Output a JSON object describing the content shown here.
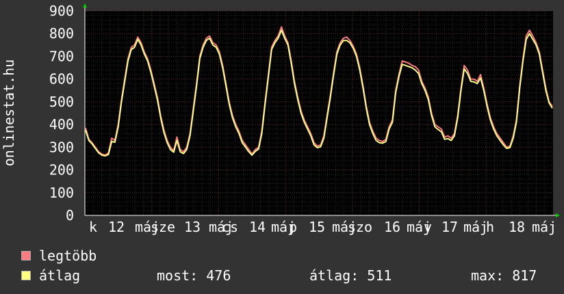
{
  "chart_data": {
    "type": "line",
    "ylabel": "onlinestat.hu",
    "ylim": [
      0,
      900
    ],
    "yticks": [
      "0",
      "100",
      "200",
      "300",
      "400",
      "500",
      "600",
      "700",
      "800",
      "900"
    ],
    "grid": true,
    "x_labels": [
      "k",
      "12",
      "máj",
      "sze",
      "13",
      "máj",
      "cs",
      "14",
      "máj",
      "p",
      "15",
      "máj",
      "szo",
      "16",
      "máj",
      "v",
      "17",
      "máj",
      "h",
      "18",
      "máj"
    ],
    "x_axis_note": "hourly samples over roughly 7 days; label sequence is day-of-week, day, month (május) as printed",
    "series": [
      {
        "name": "legtöbb",
        "color": "#ff7b82",
        "values": [
          385,
          335,
          320,
          300,
          280,
          270,
          265,
          275,
          340,
          330,
          400,
          510,
          600,
          690,
          740,
          750,
          785,
          760,
          720,
          690,
          640,
          580,
          520,
          440,
          375,
          330,
          300,
          285,
          345,
          290,
          280,
          300,
          360,
          470,
          580,
          700,
          750,
          780,
          790,
          760,
          750,
          720,
          660,
          580,
          500,
          440,
          400,
          370,
          330,
          310,
          290,
          270,
          290,
          300,
          370,
          500,
          620,
          740,
          770,
          790,
          830,
          790,
          760,
          680,
          590,
          520,
          460,
          420,
          390,
          360,
          320,
          305,
          310,
          350,
          440,
          530,
          630,
          720,
          760,
          780,
          785,
          770,
          745,
          710,
          650,
          570,
          480,
          410,
          370,
          340,
          330,
          325,
          335,
          390,
          420,
          550,
          620,
          680,
          675,
          670,
          660,
          655,
          640,
          590,
          560,
          520,
          450,
          400,
          390,
          380,
          345,
          350,
          340,
          360,
          440,
          560,
          660,
          640,
          600,
          600,
          590,
          620,
          560,
          490,
          430,
          390,
          360,
          340,
          320,
          300,
          305,
          350,
          420,
          570,
          690,
          790,
          815,
          790,
          760,
          720,
          640,
          560,
          500,
          480
        ]
      },
      {
        "name": "átlag",
        "color": "#ffff80",
        "values": [
          375,
          330,
          315,
          295,
          275,
          265,
          262,
          268,
          325,
          322,
          390,
          500,
          590,
          680,
          730,
          740,
          775,
          750,
          710,
          680,
          630,
          570,
          510,
          430,
          365,
          320,
          290,
          278,
          330,
          280,
          272,
          290,
          350,
          460,
          570,
          690,
          740,
          770,
          780,
          750,
          740,
          710,
          650,
          570,
          490,
          430,
          390,
          360,
          320,
          300,
          280,
          265,
          282,
          292,
          360,
          490,
          610,
          730,
          760,
          780,
          815,
          780,
          750,
          670,
          580,
          510,
          450,
          410,
          380,
          350,
          310,
          298,
          302,
          340,
          430,
          520,
          620,
          710,
          750,
          770,
          770,
          760,
          735,
          700,
          640,
          560,
          470,
          400,
          360,
          330,
          320,
          318,
          325,
          380,
          410,
          540,
          610,
          665,
          660,
          655,
          650,
          640,
          625,
          580,
          550,
          510,
          440,
          390,
          378,
          368,
          335,
          338,
          330,
          350,
          430,
          550,
          645,
          625,
          590,
          588,
          580,
          605,
          550,
          480,
          420,
          380,
          350,
          330,
          310,
          295,
          298,
          340,
          410,
          560,
          680,
          775,
          800,
          775,
          750,
          710,
          630,
          550,
          495,
          472
        ]
      }
    ]
  },
  "legend": [
    {
      "label": "legtöbb",
      "color": "#ff7b82"
    },
    {
      "label": "átlag",
      "color": "#ffff80"
    }
  ],
  "stats": {
    "most": "most: 476",
    "atlag": "átlag: 511",
    "max": "max: 817"
  }
}
